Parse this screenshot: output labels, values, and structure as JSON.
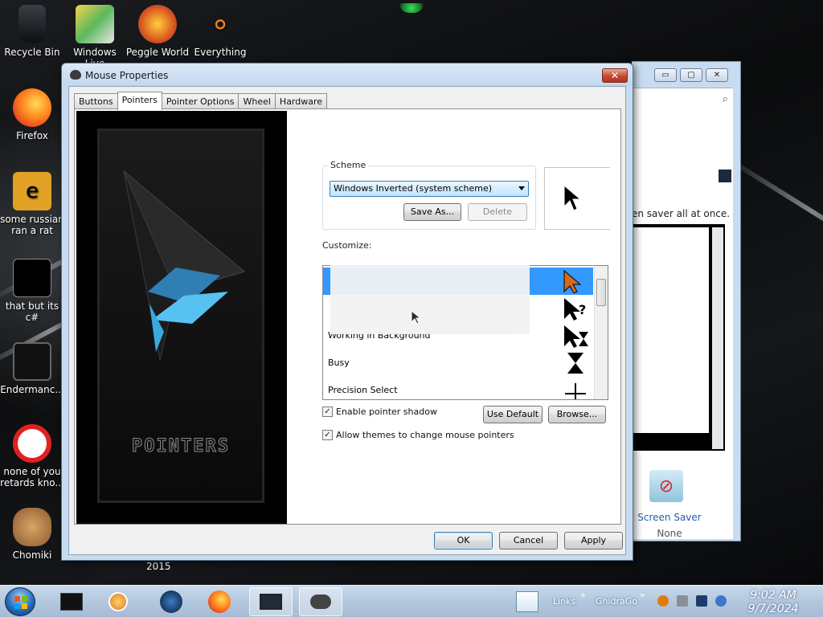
{
  "desktop": {
    "icons": [
      {
        "label": "Recycle Bin",
        "icon": "recycle-bin-icon"
      },
      {
        "label": "Windows Live",
        "icon": "windows-live-icon"
      },
      {
        "label": "Peggle World",
        "icon": "peggle-world-icon"
      },
      {
        "label": "Everything",
        "icon": "everything-search-icon"
      },
      {
        "label": "Firefox",
        "icon": "firefox-icon"
      },
      {
        "label": "some russian ran a rat",
        "icon": "folder-shortcut-icon"
      },
      {
        "label": "that but its c#",
        "icon": "folder-shortcut-icon"
      },
      {
        "label": "Endermanc...",
        "icon": "video-icon"
      },
      {
        "label": "none of you retards kno...",
        "icon": "opera-icon"
      },
      {
        "label": "Chomiki",
        "icon": "hamster-icon"
      }
    ],
    "year_label": "2015"
  },
  "background_window": {
    "tip": "en saver all at once.",
    "screen_saver_label": "Screen Saver",
    "screen_saver_value": "None",
    "caption_minimize": "▭",
    "caption_maximize": "▢",
    "caption_close": "✕"
  },
  "dialog": {
    "title": "Mouse Properties",
    "close_glyph": "✕",
    "tabs": [
      "Buttons",
      "Pointers",
      "Pointer Options",
      "Wheel",
      "Hardware"
    ],
    "active_tab": "Pointers",
    "preview_brand": "POINTERS",
    "scheme": {
      "legend": "Scheme",
      "selected": "Windows Inverted (system scheme)",
      "save_as": "Save As...",
      "delete": "Delete"
    },
    "customize_label": "Customize:",
    "cursors": [
      {
        "label": "",
        "glyph": "arrow-cursor-icon",
        "selected": true
      },
      {
        "label": "",
        "glyph": "help-select-cursor-icon",
        "selected": false
      },
      {
        "label": "Working in Background",
        "glyph": "working-background-cursor-icon",
        "selected": false
      },
      {
        "label": "Busy",
        "glyph": "busy-hourglass-cursor-icon",
        "selected": false
      },
      {
        "label": "Precision Select",
        "glyph": "crosshair-cursor-icon",
        "selected": false
      }
    ],
    "enable_shadow": {
      "label": "Enable pointer shadow",
      "checked": "✓"
    },
    "allow_themes": {
      "label": "Allow themes to change mouse pointers",
      "checked": "✓"
    },
    "use_default": "Use Default",
    "browse": "Browse...",
    "ok": "OK",
    "cancel": "Cancel",
    "apply": "Apply"
  },
  "taskbar": {
    "links_label": "Links",
    "ghidra_label": "GhidraGo",
    "chevron": "»",
    "time": "9:02 AM",
    "date": "9/7/2024"
  },
  "colors": {
    "selection": "#3399ff",
    "dialog_frame": "#c8dcf0",
    "taskbar": "#b3c8de"
  }
}
